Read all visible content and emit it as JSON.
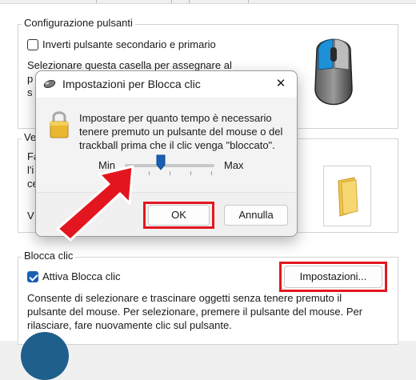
{
  "main": {
    "buttons_group": {
      "title": "Configurazione pulsanti",
      "switch_checkbox_label": "Inverti pulsante secondario e primario",
      "desc_line1": "Selezionare questa casella per assegnare al",
      "desc_line2": "p",
      "desc_line3": "s"
    },
    "speed_group": {
      "title_partial": "Ve",
      "line1": "Fa",
      "line2": "l'i",
      "line3": "ce",
      "line4": "V"
    },
    "clicklock_group": {
      "title": "Blocca clic",
      "enable_label": "Attiva Blocca clic",
      "enable_checked": true,
      "settings_button": "Impostazioni...",
      "desc_line1": "Consente di selezionare e trascinare oggetti senza tenere premuto il",
      "desc_line2": "pulsante del mouse. Per selezionare, premere il pulsante del mouse. Per",
      "desc_line3": "rilasciare, fare nuovamente clic sul pulsante."
    }
  },
  "dialog": {
    "title": "Impostazioni per Blocca clic",
    "close_glyph": "✕",
    "message_line1": "Impostare per quanto tempo è necessario",
    "message_line2": "tenere premuto un pulsante del mouse o del",
    "message_line3": "trackball prima che il clic venga \"bloccato\".",
    "slider_min_label": "Min",
    "slider_max_label": "Max",
    "slider_value": 0.4,
    "ok_button": "OK",
    "cancel_button": "Annulla"
  },
  "icons": {
    "mouse": "mouse-icon",
    "folder": "folder-icon",
    "lock": "lock-icon",
    "dialog_mouse": "mouse-small-icon",
    "arrow": "red-arrow-annotation"
  },
  "colors": {
    "accent": "#1a5fb4",
    "annotation_red": "#e3161f",
    "mouse_button_blue": "#1e90d8"
  }
}
